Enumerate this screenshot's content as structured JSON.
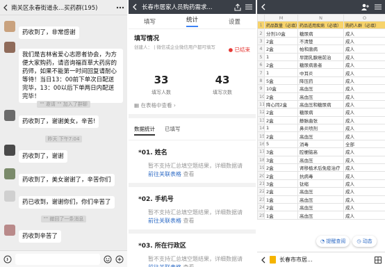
{
  "chat": {
    "title": "南关区永春街道永...买药群(195)",
    "messages": [
      {
        "text": "药收到了，非常感谢",
        "avatar_color": "#c9a27e"
      },
      {
        "text": "我们是吉林省爱心志愿者协会，为方便大家购药，请咨询福百草大药房的药师，如果不能第一时间回复请耐心等待！当日13：00前下单次日配送完毕，13：00以后下单两日内配送完毕！",
        "avatar_color": "#8f6b5a"
      },
      {
        "text": "药收到了，谢谢美女，辛苦!",
        "avatar_color": "#6b6b6b"
      },
      {
        "text": "药收到了，谢谢",
        "avatar_color": "#4a4a4a"
      },
      {
        "text": "药收到了，美女谢谢了，辛苦你们",
        "avatar_color": "#7a8a6a"
      },
      {
        "text": "药已收到，谢谢你们，你们辛苦了",
        "avatar_color": "#d0d0d0"
      },
      {
        "text": "药收到辛苦了",
        "avatar_color": "#b98a8a"
      }
    ],
    "system": [
      "\"\" 邀请 \"\" 加入了群聊",
      "昨天 下午7:04",
      "\"\" 撤回了一条消息"
    ]
  },
  "form": {
    "title": "长春市居家人员购药需求...",
    "tabs": [
      "填写",
      "统计",
      "设置"
    ],
    "active_tab": "统计",
    "status_title": "填写情况",
    "creator": "创建人：      | 微信或企业微信用户都可填写",
    "ended": "已结束",
    "filled_num": "33",
    "filled_label": "填写人数",
    "count_num": "43",
    "count_label": "填写次数",
    "view_link": "在表格中查看",
    "subtabs": [
      "数据统计",
      "已填写"
    ],
    "questions": [
      {
        "title": "*01. 姓名"
      },
      {
        "title": "*02. 手机号"
      },
      {
        "title": "*03. 所在行政区"
      }
    ],
    "q_text": "暂不支持汇总填空题结果，详细数据请",
    "q_link": "前往关联表格",
    "q_suffix": " 查看"
  },
  "sheet": {
    "col_header": [
      "M",
      "N",
      "O"
    ],
    "header_row": [
      "药品数量（必填）",
      "药品适用疾病（必填）",
      "购药人群（必填）"
    ],
    "rows": [
      [
        "2",
        "分剂10盒",
        "糖尿病",
        "成人"
      ],
      [
        "3",
        "2盒",
        "不清楚",
        "成人"
      ],
      [
        "4",
        "2盒",
        "帕和唐病",
        "成人"
      ],
      [
        "5",
        "1",
        "早期乳腺癌前治",
        "成人"
      ],
      [
        "6",
        "2盒",
        "糖尿病患者",
        "成人"
      ],
      [
        "7",
        "1",
        "中耳炎",
        "成人"
      ],
      [
        "8",
        "5盒",
        "降压药",
        "成人"
      ],
      [
        "9",
        "10盒",
        "高血压",
        "成人"
      ],
      [
        "10",
        "2盒",
        "高血压",
        "成人"
      ],
      [
        "11",
        "降心同2盒",
        "高血压和糖尿病",
        "成人"
      ],
      [
        "12",
        "2盒",
        "糖尿病",
        "成人"
      ],
      [
        "13",
        "2盒",
        "静脉曲张",
        "成人"
      ],
      [
        "14",
        "1",
        "鼻炎喷剂",
        "成人"
      ],
      [
        "15",
        "2盒",
        "高血压",
        "成人"
      ],
      [
        "16",
        "5",
        "消毒",
        "全部"
      ],
      [
        "17",
        "3盒",
        "腔梗脑高",
        "成人"
      ],
      [
        "18",
        "3盒",
        "高血压",
        "成人"
      ],
      [
        "19",
        "2盒",
        "肾移植术后免疫治疗",
        "成人"
      ],
      [
        "20",
        "2盒",
        "抗病毒",
        "成人"
      ],
      [
        "21",
        "3盒",
        "钛缩",
        "成人"
      ],
      [
        "22",
        "2盒",
        "高血压",
        "成人"
      ],
      [
        "23",
        "1盒",
        "高血压",
        "成人"
      ],
      [
        "24",
        "2盒",
        "高血压",
        "成人"
      ],
      [
        "25",
        "1盒",
        "高血压",
        "成人"
      ]
    ],
    "remind_btn": "提醒查阅",
    "activity_btn": "动态",
    "doc_name": "长春市市居...",
    "accent": "#f7d36b"
  }
}
